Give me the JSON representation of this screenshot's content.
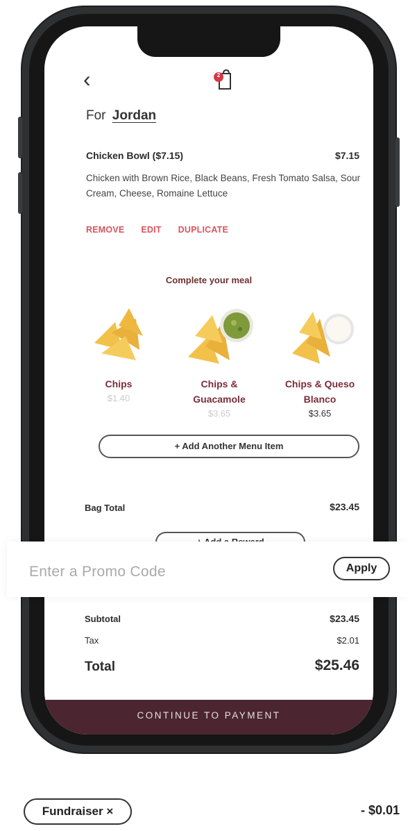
{
  "header": {
    "back_glyph": "‹",
    "bag_count": "2"
  },
  "order": {
    "for_prefix": "For",
    "for_name": "Jordan",
    "item_title": "Chicken Bowl ($7.15)",
    "item_price": "$7.15",
    "item_desc": "Chicken with Brown Rice, Black Beans, Fresh Tomato Salsa, Sour Cream, Cheese, Romaine Lettuce",
    "actions": [
      "REMOVE",
      "EDIT",
      "DUPLICATE"
    ]
  },
  "complete_meal": {
    "title": "Complete your meal",
    "sides": [
      {
        "label": "Chips",
        "price": "$1.40",
        "price_color": "#cccccc"
      },
      {
        "label": "Chips & Guacamole",
        "price": "$3.65",
        "price_color": "#cccccc"
      },
      {
        "label": "Chips & Queso Blanco",
        "price": "$3.65",
        "price_color": "#333333"
      }
    ],
    "add_item_label": "+ Add Another Menu Item"
  },
  "totals": {
    "bag_total_label": "Bag Total",
    "bag_total_value": "$23.45",
    "add_reward_label": "+ Add a Reward",
    "subtotal_label": "Subtotal",
    "subtotal_value": "$23.45",
    "tax_label": "Tax",
    "tax_value": "$2.01",
    "total_label": "Total",
    "total_value": "$25.46",
    "continue_label": "CONTINUE TO PAYMENT"
  },
  "promo": {
    "placeholder": "Enter a Promo Code",
    "apply_label": "Apply"
  },
  "fundraiser": {
    "label": "Fundraiser ×",
    "amount": "- $0.01"
  },
  "colors": {
    "accent_red": "#d9535f",
    "maroon": "#4b2630",
    "badge": "#d63848"
  }
}
